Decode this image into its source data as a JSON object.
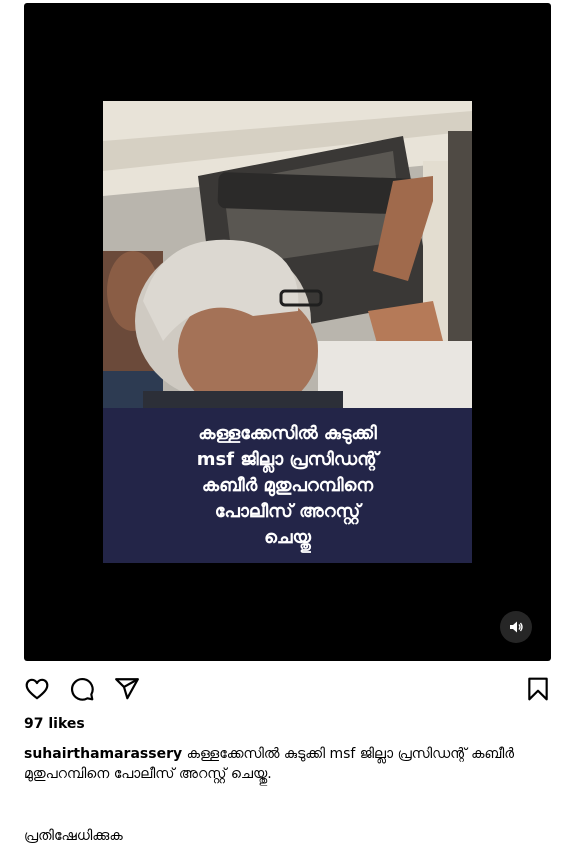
{
  "post": {
    "overlay_lines": [
      "കള്ളക്കേസിൽ കുടുക്കി",
      "msf ജില്ലാ പ്രസിഡന്റ്",
      "കബീർ മുതുപറമ്പിനെ",
      "പോലീസ് അറസ്റ്റ്",
      "ചെയ്തു"
    ],
    "mute_icon": "speaker-icon"
  },
  "actions": {
    "like_icon": "heart-icon",
    "comment_icon": "comment-bubble-icon",
    "share_icon": "paper-plane-icon",
    "save_icon": "bookmark-icon"
  },
  "likes": "97 likes",
  "caption": {
    "username": "suhairthamarassery",
    "text": "കള്ളക്കേസിൽ കുടുക്കി msf ജില്ലാ പ്രസിഡന്റ് കബീർ മുതുപറമ്പിനെ പോലീസ് അറസ്റ്റ് ചെയ്തു."
  },
  "comment": "പ്രതിഷേധിക്കുക",
  "colors": {
    "overlay_bg": "#26284e",
    "media_bg": "#000000"
  }
}
